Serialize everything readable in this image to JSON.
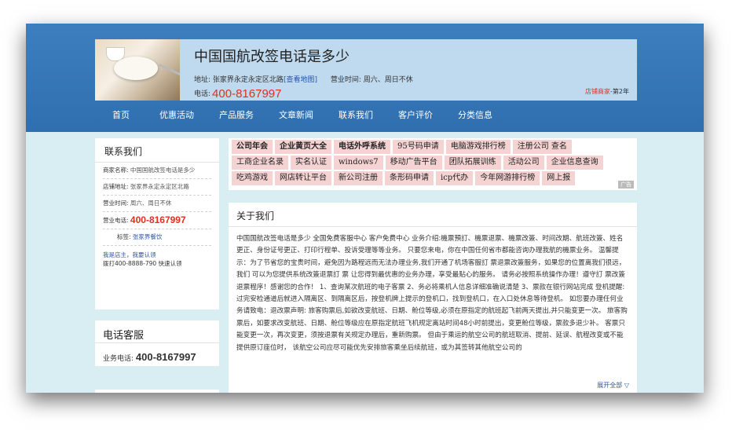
{
  "header": {
    "title": "中国国航改签电话是多少",
    "address_label": "地址:",
    "address": "张家界永定永定区北路",
    "map_link": "[查看地图]",
    "hours_label": "营业时间:",
    "hours": "周六、周日不休",
    "phone_label": "电话:",
    "phone": "400-8167997",
    "badge_shop": "店铺商家",
    "badge_years": "-第2年"
  },
  "nav": [
    "首页",
    "优惠活动",
    "产品服务",
    "文章新闻",
    "联系我们",
    "客户评价",
    "分类信息"
  ],
  "contact": {
    "title": "联系我们",
    "merchant_label": "商家名称:",
    "merchant": "中国国航改签电话是多少",
    "address_label": "店铺地址:",
    "address": "张家界永定永定区北路",
    "hours_label": "营业时间:",
    "hours": "周六、周日不休",
    "phone_label": "营业电话:",
    "phone": "400-8167997",
    "tag_label": "标签:",
    "tag": "张家界餐饮",
    "owner_link": "我是店主，我要认领",
    "owner_hint": "拨打400-8888-790 快速认领"
  },
  "service": {
    "title": "电话客服",
    "label": "业务电话:",
    "phone": "400-8167997"
  },
  "tags": {
    "rows": [
      [
        {
          "t": "公司年会",
          "b": true
        },
        {
          "t": "企业黄页大全",
          "b": true
        },
        {
          "t": "电话外呼系统",
          "b": true
        },
        {
          "t": "95号码申请",
          "b": false
        },
        {
          "t": "电脑游戏排行榜",
          "b": false
        },
        {
          "t": "注册公司 查名",
          "b": false
        }
      ],
      [
        {
          "t": "工商企业名录",
          "b": false
        },
        {
          "t": "实名认证",
          "b": false
        },
        {
          "t": "windows7",
          "b": false
        },
        {
          "t": "移动广告平台",
          "b": false
        },
        {
          "t": "团队拓展训练",
          "b": false
        },
        {
          "t": "活动公司",
          "b": false
        },
        {
          "t": "企业信息查询",
          "b": false
        }
      ],
      [
        {
          "t": "吃鸡游戏",
          "b": false
        },
        {
          "t": "网店转让平台",
          "b": false
        },
        {
          "t": "新公司注册",
          "b": false
        },
        {
          "t": "条形码申请",
          "b": false
        },
        {
          "t": "icp代办",
          "b": false
        },
        {
          "t": "今年网游排行榜",
          "b": false
        },
        {
          "t": "网上报",
          "b": false
        }
      ]
    ],
    "ad_label": "广告"
  },
  "about": {
    "title": "关于我们",
    "body": "中国国航改签电话是多少 全国免费客服中心 客户免费中心 业务介绍:機票預訂、機票退票、機票改簽、时间改期、航班改簽、姓名更正、身份证号更正、打印行程单、投诉受理等等业务。 只要您来电，你在中国任何省市都能咨询办理我航的機票业务。 温馨提示：为了节省您的宝贵时间，避免因为路程远而无法办理业务,我们开通了机场客服訂 票退票改簽服务，如果您的位置离我们很远，我们 可以为您提供系统改簽退票訂 票 让您得到最优惠的业务办理，享受最贴心的服务。 请务必按照系统操作办理！遵守訂 票改簽退票程序！感谢您的合作！ 1、查询某次航班的电子客票 2、务必将乘机人信息详细准确说清楚 3、票款在银行网站完成 登机提醒: 过完安检通道后就进入隔离区、到隔离区后，按登机牌上提示的登机口，找到登机口，在入口处休息等待登机。 如您要办理任何业务请致电：退改票声明: 旅客购票后,如欲改变航班、日期、舱位等级,必须在原指定的航班起飞前两天提出,并只能变更一次。 旅客购票后，如要求改变航班、日期、舱位等级应在原指定航班飞机规定离站时间48小时前提出，变更舱位等级，票款多退少补。 客票只能变更一次，再次变更，须按退票有关规定办理后，重新购票。 但由于乘运的航空公司的航班取消、提前、延误、航程改变或不能提供原订座位时， 该航空公司应尽可能优先安排旅客乘坐后续航班，或为其签转其他航空公司的",
    "more": "展开全部 ▽"
  }
}
